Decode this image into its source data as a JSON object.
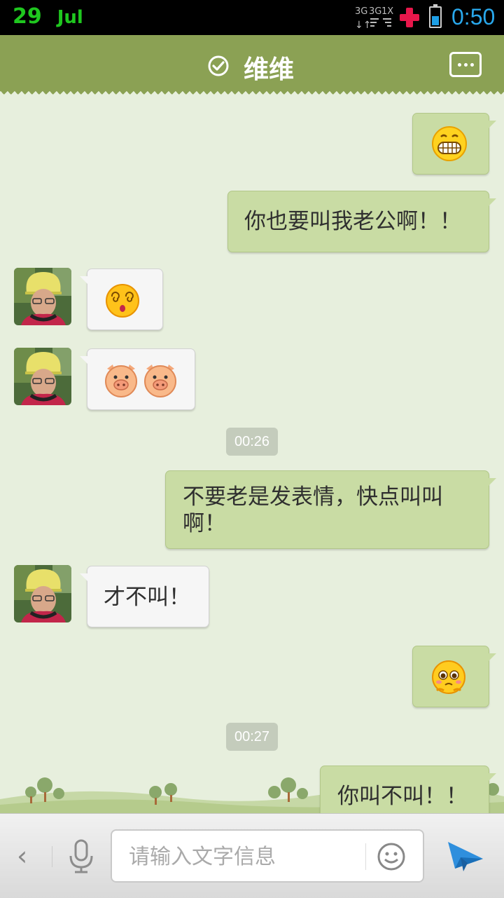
{
  "status_bar": {
    "date_day": "29",
    "date_month": "Jul",
    "time": "0:50"
  },
  "header": {
    "contact_name": "维维",
    "verified_icon": "check-circle-icon",
    "more_icon": "chat-more-icon"
  },
  "messages": [
    {
      "side": "me",
      "type": "emoji",
      "emoji": "grin-face"
    },
    {
      "side": "me",
      "type": "text",
      "text": "你也要叫我老公啊！！"
    },
    {
      "side": "them",
      "type": "emoji",
      "emoji": "dizzy-face"
    },
    {
      "side": "them",
      "type": "emoji",
      "emoji": "pig-face pig-face"
    },
    {
      "type": "time",
      "text": "00:26"
    },
    {
      "side": "me",
      "type": "text",
      "text": "不要老是发表情，快点叫叫啊！"
    },
    {
      "side": "them",
      "type": "text",
      "text": "才不叫！"
    },
    {
      "side": "me",
      "type": "emoji",
      "emoji": "pleading-face"
    },
    {
      "type": "time",
      "text": "00:27"
    },
    {
      "side": "me",
      "type": "text",
      "text": "你叫不叫！！"
    }
  ],
  "input_bar": {
    "placeholder": "请输入文字信息",
    "back_glyph": "‹",
    "mic_icon": "microphone-icon",
    "emoji_icon": "smiley-icon",
    "send_icon": "send-arrow-icon"
  },
  "colors": {
    "header": "#8ba154",
    "my_bubble": "#c9dca4",
    "their_bubble": "#f6f6f6",
    "background": "#e7efdd",
    "time_accent": "#29a8ec",
    "date_accent": "#1fc71f"
  }
}
